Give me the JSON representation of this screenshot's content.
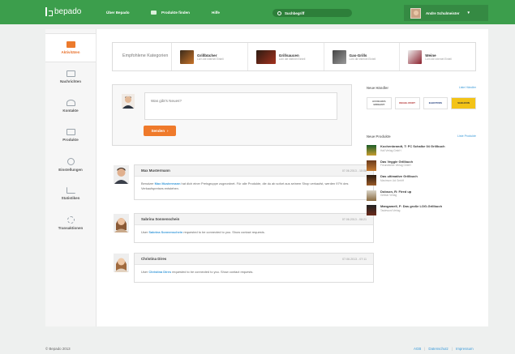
{
  "brand": {
    "name": "bepado",
    "color": "#3c9e4c"
  },
  "topnav": {
    "items": [
      {
        "label": "Über Bepado"
      },
      {
        "label": "Produkte finden"
      },
      {
        "label": "Hilfe"
      }
    ],
    "search_placeholder": "Suchbegriff",
    "user_name": "Andre Schulmeister"
  },
  "sidebar": {
    "items": [
      {
        "label": "Aktivitäten",
        "icon": "activity-icon",
        "active": true
      },
      {
        "label": "Nachrichten",
        "icon": "messages-icon"
      },
      {
        "label": "Kontakte",
        "icon": "contacts-icon"
      },
      {
        "label": "Produkte",
        "icon": "products-icon"
      },
      {
        "label": "Einstellungen",
        "icon": "settings-icon"
      },
      {
        "label": "Statistiken",
        "icon": "statistics-icon"
      },
      {
        "label": "Transaktionen",
        "icon": "transactions-icon"
      }
    ]
  },
  "categories": {
    "label": "Empfohlene Kategorien",
    "items": [
      {
        "title": "Grillbücher",
        "sub": "Lorn die internet Eintell"
      },
      {
        "title": "Grillsaucen",
        "sub": "Lorn die internet Eintell"
      },
      {
        "title": "Gas-Grills",
        "sub": "Lorn die internet Eintell"
      },
      {
        "title": "Weine",
        "sub": "Lorn die internet Eintell"
      }
    ]
  },
  "composer": {
    "placeholder": "Was gibt's Neues?",
    "send_label": "Senden"
  },
  "feed": [
    {
      "name": "Max Mustermann",
      "time": "07.06.2013 - 10:06",
      "pre": "Benutzer",
      "link": "Max Mustermann",
      "post": "hat dich einer Preisgruppe zugeordnet. Für alle Produkte, die du ab sofort aus seinem Shop verkaufst, werden 97% des Verkaufspreises entstehen."
    },
    {
      "name": "Sabrina Sonnenschein",
      "time": "07.06.2013 - 08:21",
      "pre": "User",
      "link": "Sabrina Sonnenschein",
      "post": "requested to be connected to you. Show contact requests."
    },
    {
      "name": "Christina Dires",
      "time": "07.06.2013 - 07:11",
      "pre": "User",
      "link": "Christina Dires",
      "post": "requested to be connected to you. Show contact requests."
    }
  ],
  "dealers": {
    "title": "Neue Händler",
    "link": "Liste Händler",
    "items": [
      {
        "name": "ACCELERA BRIGANT"
      },
      {
        "name": "KEGEL ROOT"
      },
      {
        "name": "ELEKTROS"
      },
      {
        "name": "SHELDON"
      }
    ]
  },
  "new_products": {
    "title": "Neue Produkte",
    "link": "Liste Produkte",
    "items": [
      {
        "title": "Kochenbrandt, T: FC Schalke 04 Grillbuch",
        "sub": "Hall Verlag GmbH"
      },
      {
        "title": "Das Veggie Grillbuch",
        "sub": "Freundlicher Verlag GmbH"
      },
      {
        "title": "Das ultimative Grillbuch",
        "sub": "Maximum Ltd GmbH"
      },
      {
        "title": "Dobson, R: Fired up",
        "sub": "Grillbar Verlag"
      },
      {
        "title": "Mangamell, F: Das große LOG-Grillbuch",
        "sub": "Tasteword Verlag"
      }
    ]
  },
  "footer": {
    "copyright": "© Bepado 2013",
    "links": [
      {
        "label": "AGB"
      },
      {
        "label": "Datenschutz"
      },
      {
        "label": "Impressum"
      }
    ]
  }
}
